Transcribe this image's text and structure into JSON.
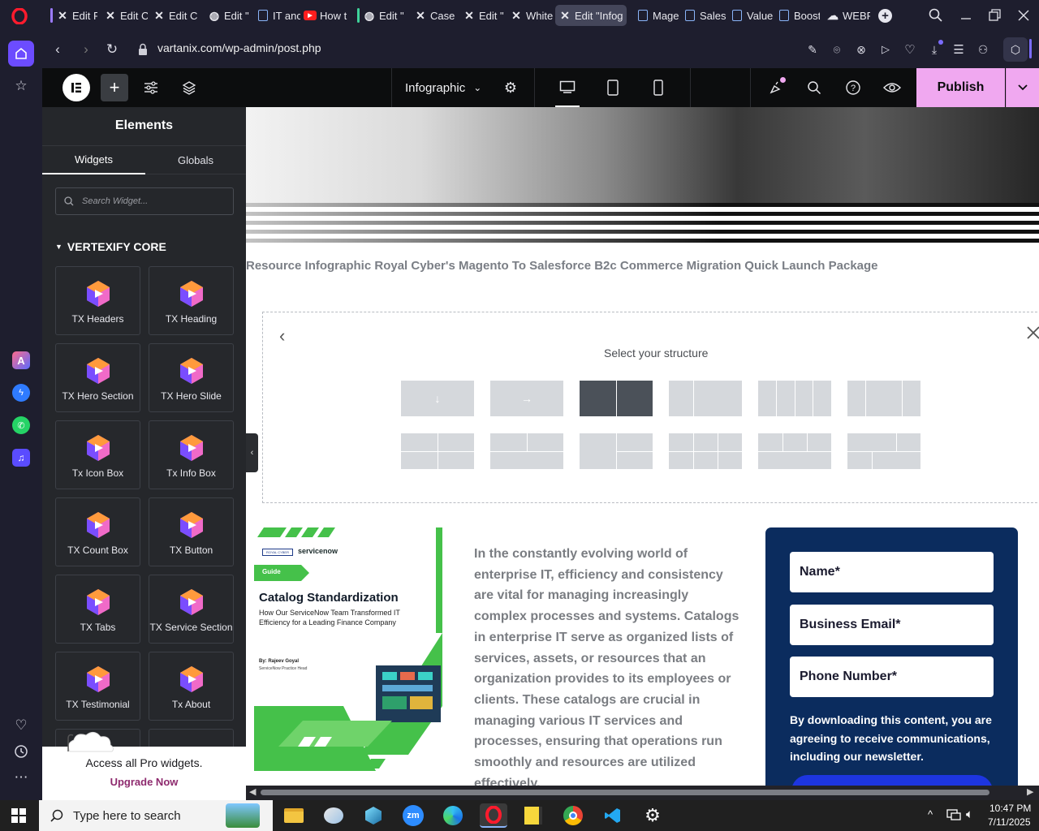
{
  "browser": {
    "tabs": [
      {
        "label": "Edit P"
      },
      {
        "label": "Edit C"
      },
      {
        "label": "Edit C"
      },
      {
        "label": "Edit \""
      },
      {
        "label": "IT anc"
      },
      {
        "label": "How t"
      },
      {
        "label": "Edit \""
      },
      {
        "label": "Case"
      },
      {
        "label": "Edit \""
      },
      {
        "label": "White"
      },
      {
        "label": "Edit \"Infog"
      },
      {
        "label": "Mage"
      },
      {
        "label": "Sales"
      },
      {
        "label": "Value"
      },
      {
        "label": "Boost"
      },
      {
        "label": "WEBP"
      }
    ],
    "new_tab": "+",
    "url": "vartanix.com/wp-admin/post.php"
  },
  "editor": {
    "page_name": "Infographic",
    "publish_label": "Publish"
  },
  "panel": {
    "title": "Elements",
    "tabs": [
      "Widgets",
      "Globals"
    ],
    "search_placeholder": "Search Widget...",
    "category": "VERTEXIFY CORE",
    "widgets": [
      "TX Headers",
      "TX Heading",
      "TX Hero Section",
      "TX Hero Slide",
      "Tx Icon Box",
      "Tx Info Box",
      "TX Count Box",
      "TX Button",
      "TX Tabs",
      "TX Service Section",
      "TX Testimonial",
      "Tx About"
    ],
    "promo_text": "Access all Pro widgets.",
    "promo_link": "Upgrade Now"
  },
  "canvas": {
    "page_heading": "Resource Infographic Royal Cyber's Magento To Salesforce B2c Commerce Migration Quick Launch Package",
    "structure_title": "Select your structure",
    "structure_arrows": [
      "↓",
      "→"
    ],
    "card": {
      "brand_left": "ROYAL CYBER",
      "brand_right": "servicenow",
      "badge": "Guide",
      "title": "Catalog Standardization",
      "subtitle": "How Our ServiceNow Team Transformed IT Efficiency for a Leading Finance Company",
      "author": "By: Rajeev Goyal",
      "author_role": "ServiceNow Practice Head"
    },
    "body_text": "In the constantly evolving world of enterprise IT, efficiency and consistency are vital for managing increasingly complex processes and systems. Catalogs in enterprise IT serve as organized lists of services, assets, or resources that an organization provides to its employees or clients. These catalogs are crucial in managing various IT services and processes, ensuring that operations run smoothly and resources are utilized effectively.",
    "form": {
      "fields": [
        "Name*",
        "Business Email*",
        "Phone Number*"
      ],
      "consent": "By downloading this content, you are agreeing to receive communications, including our newsletter."
    }
  },
  "taskbar": {
    "search_placeholder": "Type here to search",
    "time": "10:47 PM",
    "date": "7/11/2025"
  },
  "colors": {
    "publish_bg": "#f0a8f0",
    "form_bg": "#0b2c5e",
    "green": "#45c14a"
  }
}
